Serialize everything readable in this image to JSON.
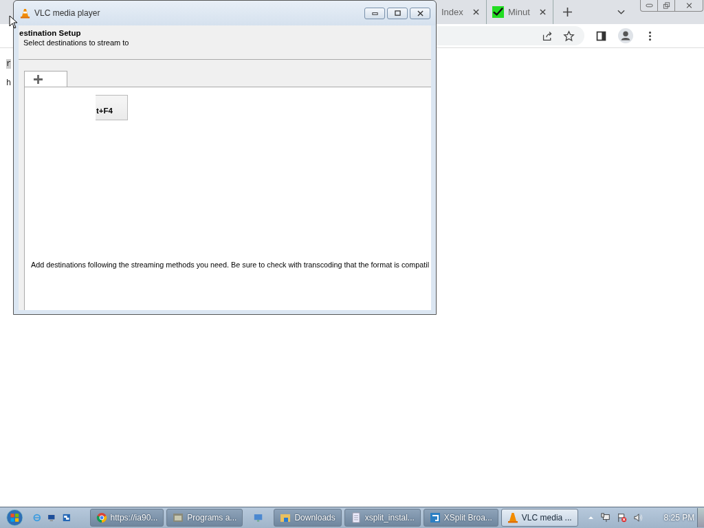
{
  "browser": {
    "tabs": [
      {
        "label": "Index"
      },
      {
        "label": "Minut"
      }
    ],
    "page_lines": [
      "r",
      "h"
    ]
  },
  "vlc_window": {
    "title": "VLC media player",
    "heading": "estination Setup",
    "subheading": "Select destinations to stream to",
    "button": "t+F4",
    "hint": "Add destinations following the streaming methods you need. Be sure to check with transcoding that the format is compatil"
  },
  "taskbar": {
    "items": [
      {
        "kind": "labeled",
        "label": "https://ia90...",
        "active": false
      },
      {
        "kind": "labeled",
        "label": "Programs a...",
        "active": false
      },
      {
        "kind": "icon",
        "active": false
      },
      {
        "kind": "labeled",
        "label": "Downloads",
        "active": false
      },
      {
        "kind": "labeled",
        "label": "xsplit_instal...",
        "active": false
      },
      {
        "kind": "labeled",
        "label": "XSplit Broa...",
        "active": false
      },
      {
        "kind": "labeled",
        "label": "VLC media ...",
        "active": true
      }
    ],
    "clock": "8:25 PM"
  }
}
